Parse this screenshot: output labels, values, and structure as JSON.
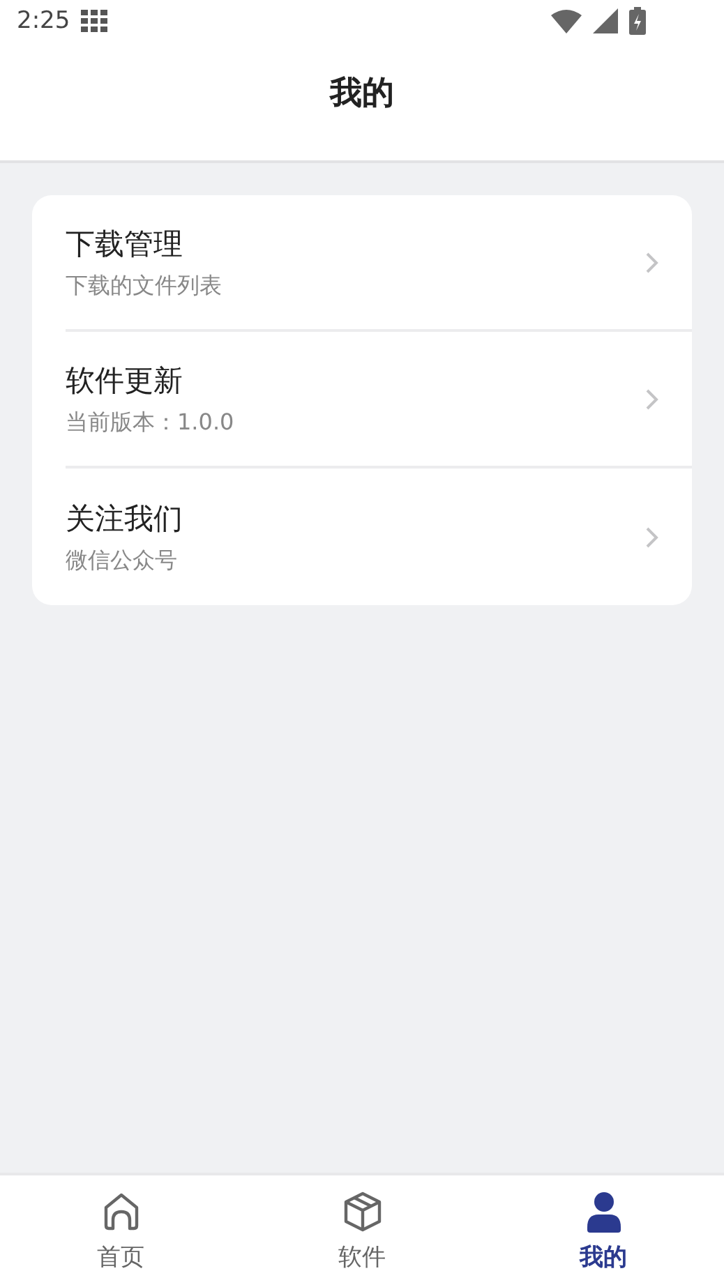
{
  "status_bar": {
    "time": "2:25"
  },
  "header": {
    "title": "我的"
  },
  "menu": [
    {
      "title": "下载管理",
      "subtitle": "下载的文件列表"
    },
    {
      "title": "软件更新",
      "subtitle": "当前版本：1.0.0"
    },
    {
      "title": "关注我们",
      "subtitle": "微信公众号"
    }
  ],
  "tab_bar": [
    {
      "label": "首页",
      "kind": "home",
      "selected": false
    },
    {
      "label": "软件",
      "kind": "box",
      "selected": false
    },
    {
      "label": "我的",
      "kind": "person",
      "selected": true
    }
  ]
}
